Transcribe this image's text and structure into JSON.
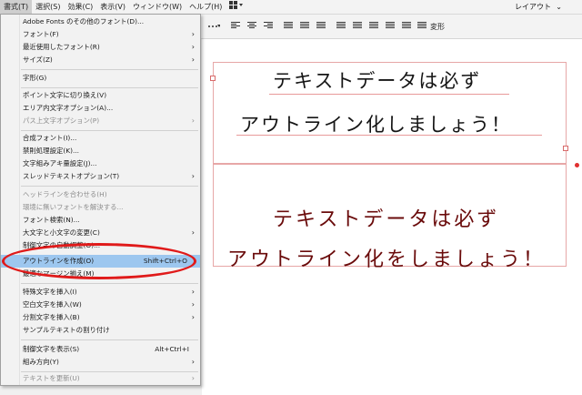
{
  "menubar": {
    "items": [
      "書式(T)",
      "選択(S)",
      "効果(C)",
      "表示(V)",
      "ウィンドウ(W)",
      "ヘルプ(H)"
    ],
    "layout_icon": "layout-grid-icon",
    "workspace": "レイアウト"
  },
  "toolbar": {
    "transform_label": "変形"
  },
  "menu": {
    "items": [
      {
        "label": "Adobe Fonts のその他のフォント(D)...",
        "shortcut": "",
        "submenu": false,
        "disabled": false
      },
      {
        "label": "フォント(F)",
        "shortcut": "",
        "submenu": true,
        "disabled": false
      },
      {
        "label": "最近使用したフォント(R)",
        "shortcut": "",
        "submenu": true,
        "disabled": false
      },
      {
        "label": "サイズ(Z)",
        "shortcut": "",
        "submenu": true,
        "disabled": false
      },
      {
        "label": "字形(G)",
        "shortcut": "",
        "submenu": false,
        "disabled": false
      },
      {
        "label": "ポイント文字に切り換え(V)",
        "shortcut": "",
        "submenu": false,
        "disabled": false
      },
      {
        "label": "エリア内文字オプション(A)...",
        "shortcut": "",
        "submenu": false,
        "disabled": false
      },
      {
        "label": "パス上文字オプション(P)",
        "shortcut": "",
        "submenu": true,
        "disabled": true
      },
      {
        "label": "合成フォント(I)...",
        "shortcut": "",
        "submenu": false,
        "disabled": false
      },
      {
        "label": "禁則処理設定(K)...",
        "shortcut": "",
        "submenu": false,
        "disabled": false
      },
      {
        "label": "文字組みアキ量設定(J)...",
        "shortcut": "",
        "submenu": false,
        "disabled": false
      },
      {
        "label": "スレッドテキストオプション(T)",
        "shortcut": "",
        "submenu": true,
        "disabled": false
      },
      {
        "label": "ヘッドラインを合わせる(H)",
        "shortcut": "",
        "submenu": false,
        "disabled": true
      },
      {
        "label": "環境に無いフォントを解決する...",
        "shortcut": "",
        "submenu": false,
        "disabled": true
      },
      {
        "label": "フォント検索(N)...",
        "shortcut": "",
        "submenu": false,
        "disabled": false
      },
      {
        "label": "大文字と小文字の変更(C)",
        "shortcut": "",
        "submenu": true,
        "disabled": false
      },
      {
        "label": "制御文字の自動調整(O)...",
        "shortcut": "",
        "submenu": false,
        "disabled": false
      },
      {
        "label": "アウトラインを作成(O)",
        "shortcut": "Shift+Ctrl+O",
        "submenu": false,
        "disabled": false,
        "highlighted": true
      },
      {
        "label": "最適なマージン揃え(M)",
        "shortcut": "",
        "submenu": false,
        "disabled": false
      },
      {
        "label": "特殊文字を挿入(I)",
        "shortcut": "",
        "submenu": true,
        "disabled": false
      },
      {
        "label": "空白文字を挿入(W)",
        "shortcut": "",
        "submenu": true,
        "disabled": false
      },
      {
        "label": "分割文字を挿入(B)",
        "shortcut": "",
        "submenu": true,
        "disabled": false
      },
      {
        "label": "サンプルテキストの割り付け",
        "shortcut": "",
        "submenu": false,
        "disabled": false
      },
      {
        "label": "制御文字を表示(S)",
        "shortcut": "Alt+Ctrl+I",
        "submenu": false,
        "disabled": false
      },
      {
        "label": "組み方向(Y)",
        "shortcut": "",
        "submenu": true,
        "disabled": false
      },
      {
        "label": "テキストを更新(U)",
        "shortcut": "",
        "submenu": true,
        "disabled": true
      }
    ]
  },
  "canvas": {
    "text_frame_1": {
      "line1": "テキストデータは必ず",
      "line2": "アウトライン化しましょう！",
      "color": "#151515"
    },
    "text_frame_2": {
      "line1": "テキストデータは必ず",
      "line2": "アウトライン化をしましょう！",
      "color": "#6a0b0b"
    }
  },
  "colors": {
    "highlight": "#9dc7ef",
    "annotation_oval": "#e01a1a",
    "selection_frame": "#e7a7a7"
  }
}
